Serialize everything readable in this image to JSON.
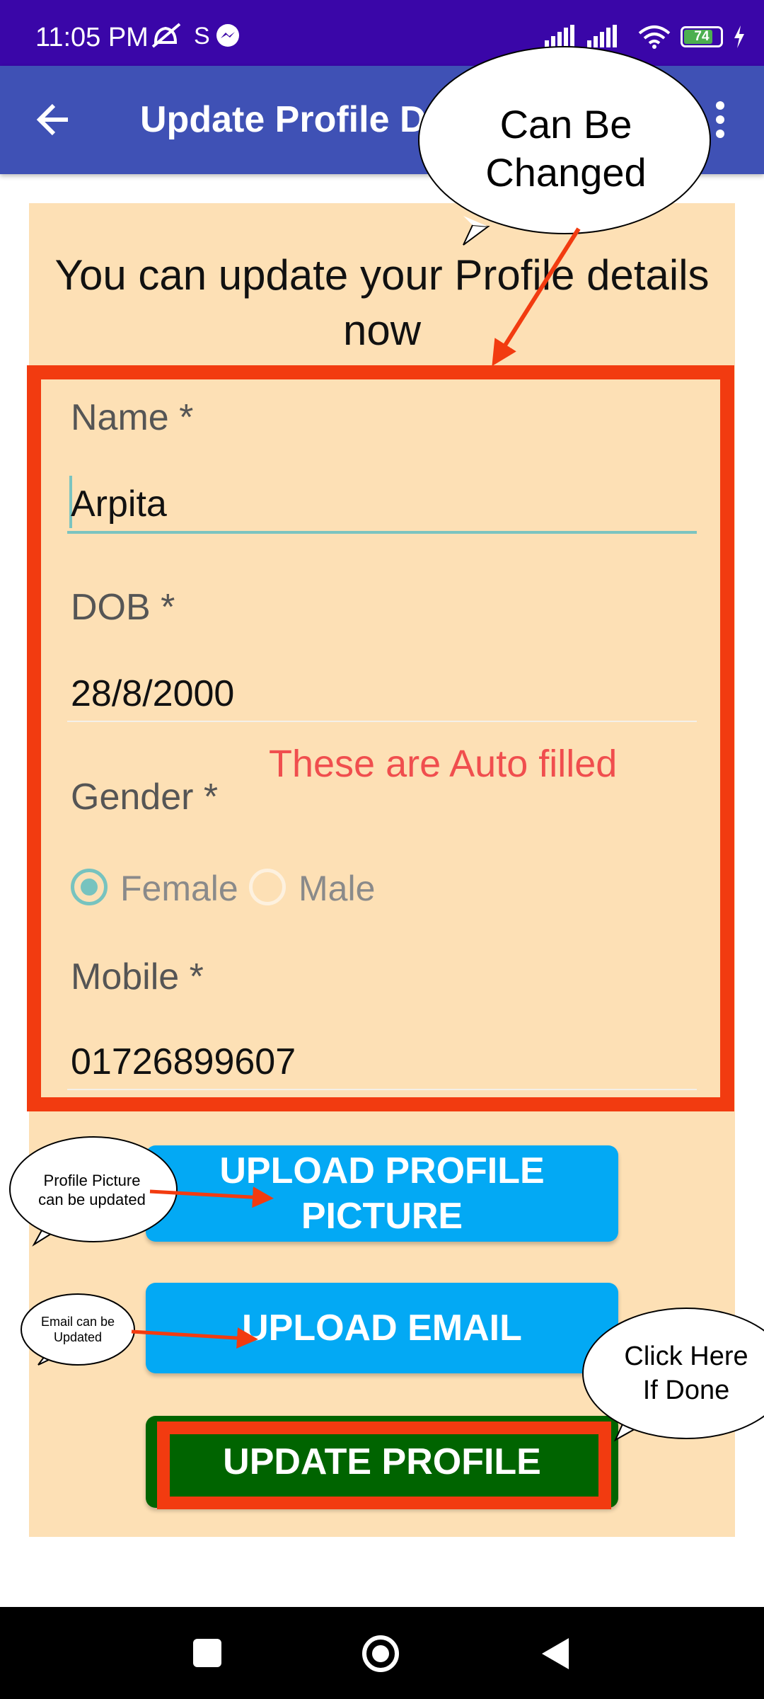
{
  "status_bar": {
    "time": "11:05 PM",
    "battery_level": "74",
    "icons": [
      "alarm-off-icon",
      "sim-icon",
      "messenger-icon",
      "signal-icon",
      "signal-icon",
      "wifi-icon",
      "battery-icon",
      "charging-icon"
    ]
  },
  "app_bar": {
    "title": "Update Profile Details",
    "back_icon": "arrow-left-icon",
    "menu_icon": "more-vertical-icon"
  },
  "form": {
    "intro_text": "You can update your Profile details now",
    "name": {
      "label": "Name *",
      "value": "Arpita"
    },
    "dob": {
      "label": "DOB *",
      "value": "28/8/2000"
    },
    "gender": {
      "label": "Gender *",
      "options": [
        "Female",
        "Male"
      ],
      "selected": "Female"
    },
    "mobile": {
      "label": "Mobile *",
      "value": "01726899607"
    },
    "buttons": {
      "upload_picture_line1": "UPLOAD PROFILE",
      "upload_picture_line2": "PICTURE",
      "upload_email": "UPLOAD EMAIL",
      "update_profile": "UPDATE PROFILE"
    }
  },
  "annotations": {
    "can_be_changed_line1": "Can Be",
    "can_be_changed_line2": "Changed",
    "auto_filled": "These are Auto filled",
    "profile_picture_line1": "Profile Picture",
    "profile_picture_line2": "can be updated",
    "email_line1": "Email can be",
    "email_line2": "Updated",
    "click_here_line1": "Click Here",
    "click_here_line2": "If Done"
  },
  "colors": {
    "status_bar": "#3a06a8",
    "app_bar": "#3f51b5",
    "panel": "#fde0b5",
    "highlight": "#f23b10",
    "button_blue": "#03a9f4",
    "button_green": "#006400",
    "accent_teal": "#7bc4c0",
    "auto_fill_note": "#f04e4e"
  }
}
